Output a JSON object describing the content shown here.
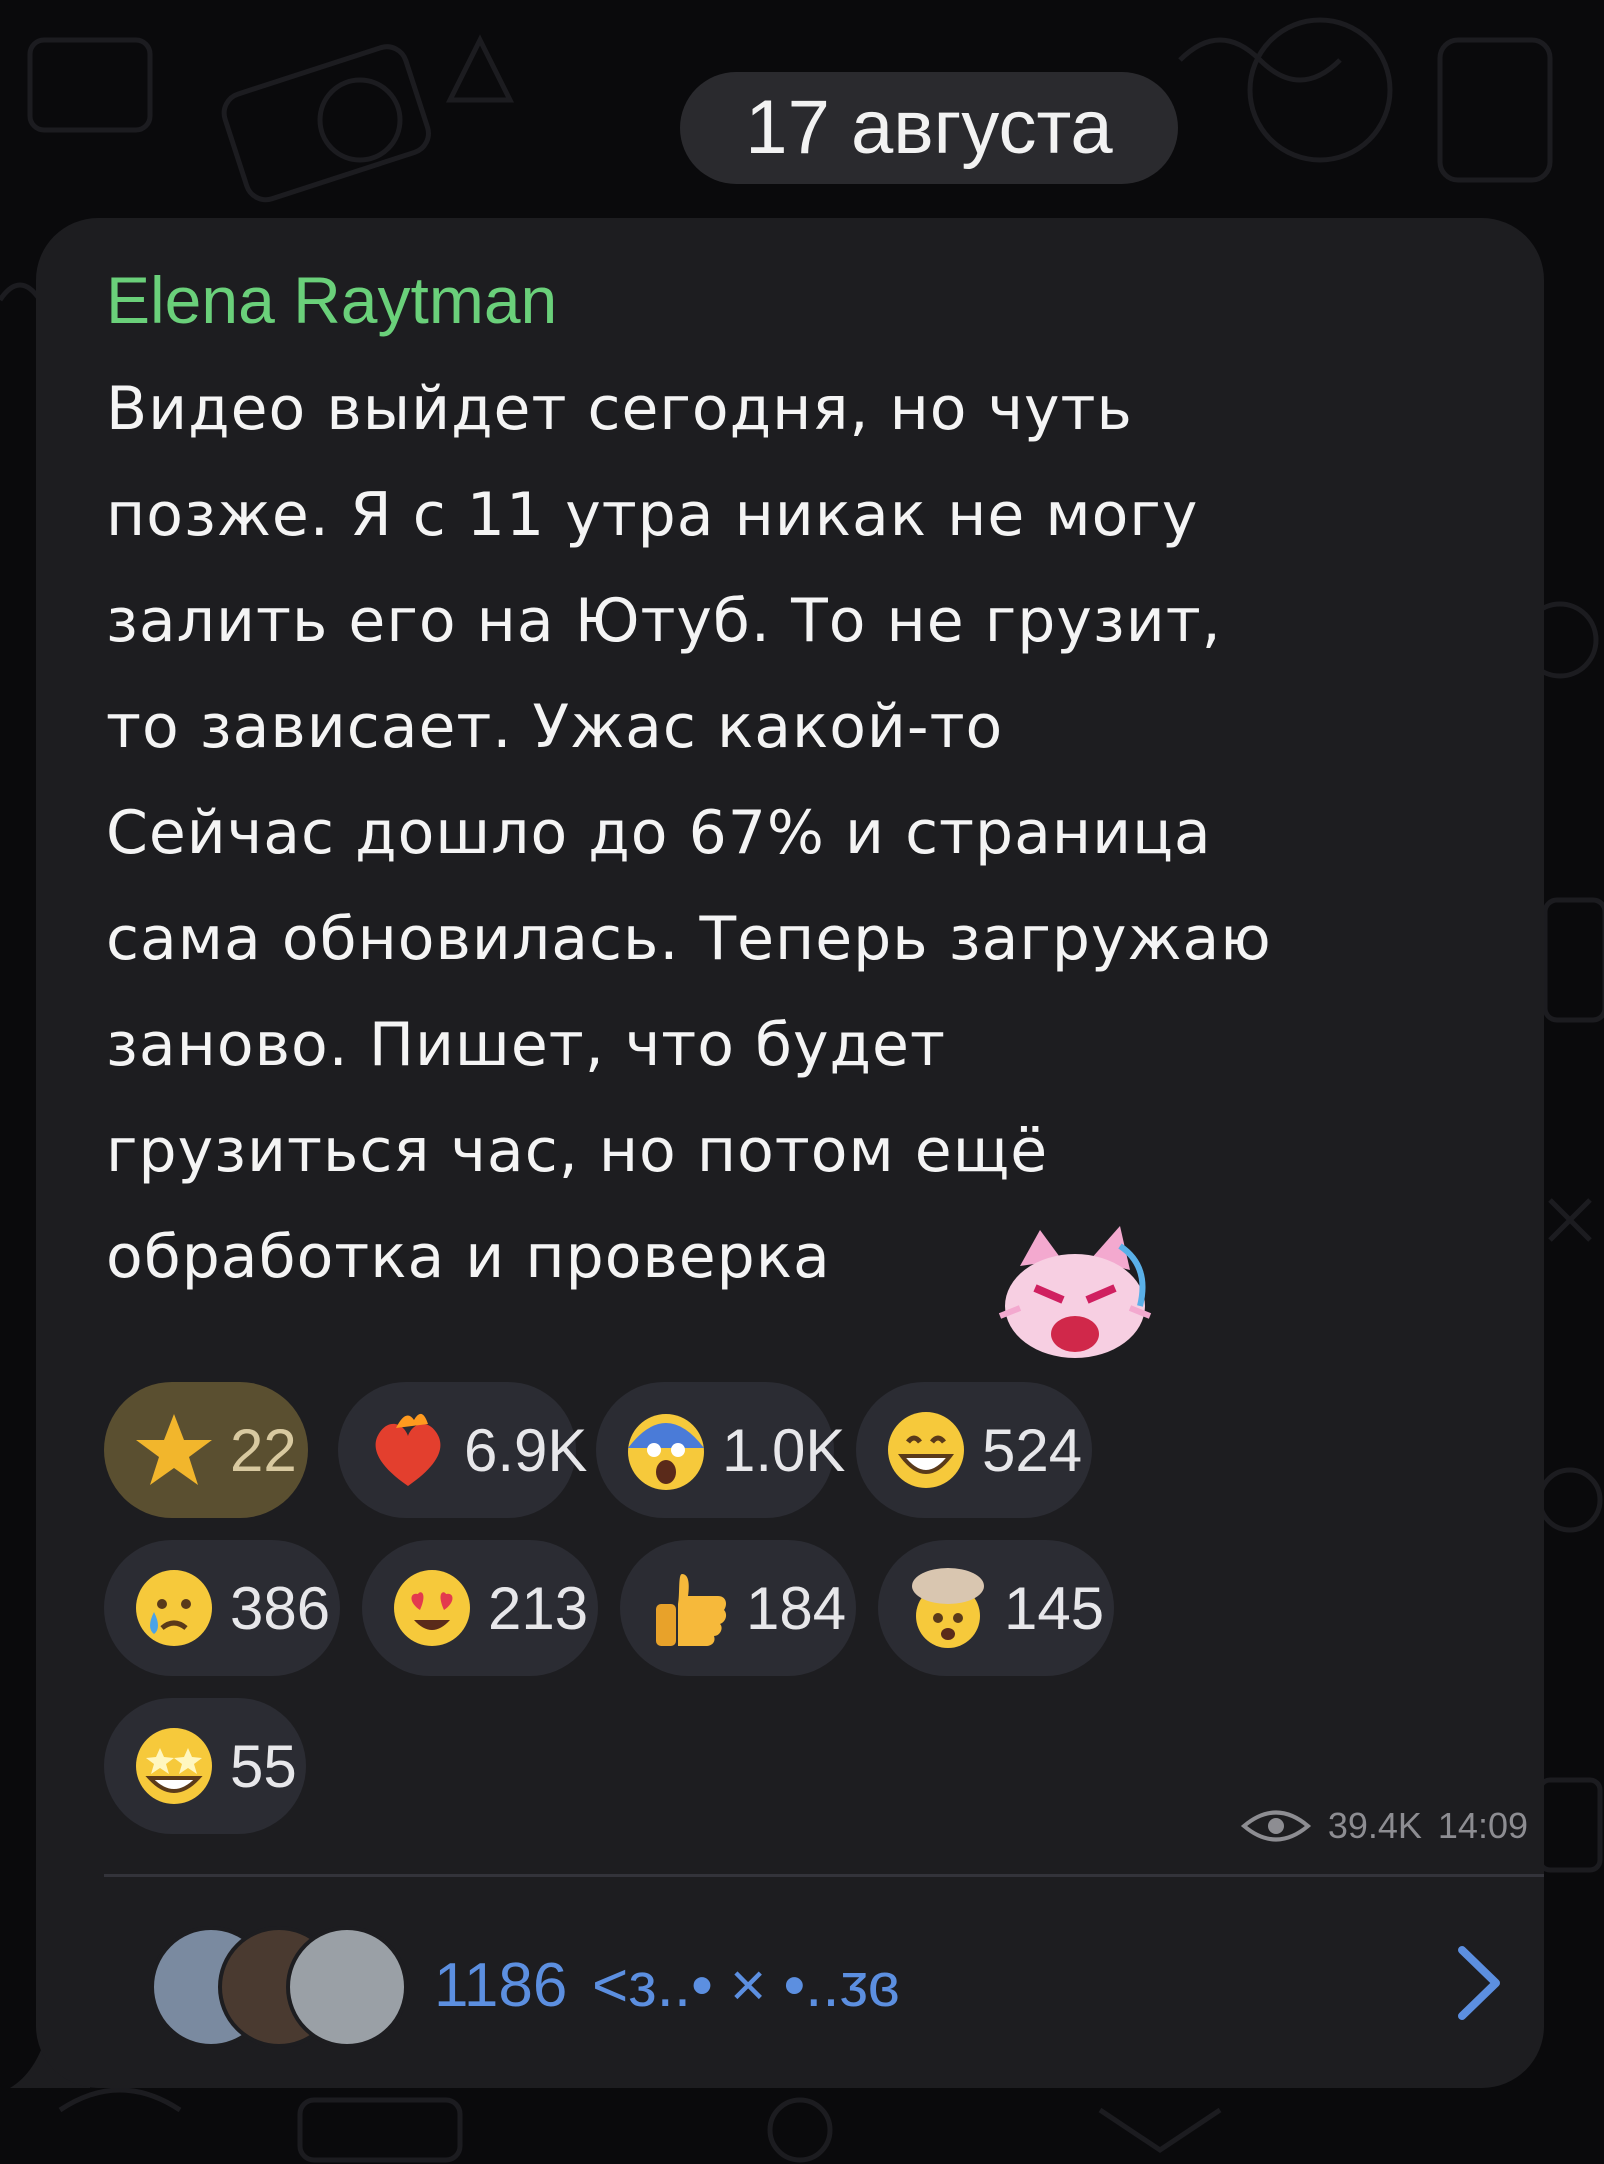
{
  "date_label": "17 августа",
  "post": {
    "author": "Elena Raytman",
    "lines": [
      "Видео выйдет сегодня, но чуть",
      "позже. Я с 11 утра никак не могу",
      "залить его на Ютуб. То не грузит,",
      "то зависает. Ужас какой-то",
      "Сейчас дошло до 67% и страница",
      "сама обновилась. Теперь загружаю",
      "заново. Пишет, что будет",
      "грузиться час, но потом ещё",
      "обработка и проверка"
    ],
    "sticker_icon": "angry-cat-sticker",
    "reactions": [
      {
        "icon": "star-icon",
        "count": "22",
        "chosen": true
      },
      {
        "icon": "heart-on-fire-icon",
        "count": "6.9K"
      },
      {
        "icon": "screaming-face-icon",
        "count": "1.0K"
      },
      {
        "icon": "grinning-face-icon",
        "count": "524"
      },
      {
        "icon": "crying-face-icon",
        "count": "386"
      },
      {
        "icon": "heart-eyes-face-icon",
        "count": "213"
      },
      {
        "icon": "thumbs-up-icon",
        "count": "184"
      },
      {
        "icon": "exploding-head-icon",
        "count": "145"
      },
      {
        "icon": "star-struck-face-icon",
        "count": "55"
      }
    ],
    "views": "39.4K",
    "time": "14:09"
  },
  "comments": {
    "label": "1186 ㄹ<ᴈ..•×•..ᴣɞ",
    "label_text": "1186",
    "label_suffix": "<ᴈ..• × •..ᴣɞ",
    "avatars": [
      "avatar-1",
      "avatar-2",
      "avatar-3"
    ]
  },
  "colors": {
    "background": "#0a0a0c",
    "bubble": "#1d1d20",
    "author": "#6ad07a",
    "link": "#5c8fe0",
    "pill": "#2b2c33",
    "pill_chosen": "#5a4f30"
  }
}
